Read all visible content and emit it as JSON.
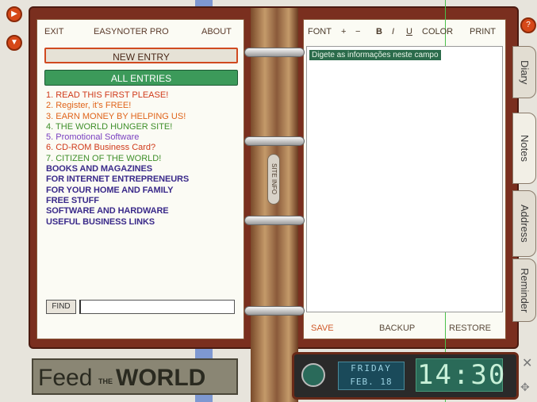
{
  "left_menu": {
    "exit": "EXIT",
    "title": "EASYNOTER PRO",
    "about": "ABOUT"
  },
  "buttons": {
    "new_entry": "NEW ENTRY",
    "all_entries": "ALL ENTRIES",
    "find": "FIND"
  },
  "entries": [
    {
      "text": "1. READ THIS FIRST PLEASE!",
      "color": "#d03a1a"
    },
    {
      "text": "2. Register, it's FREE!",
      "color": "#e0641a"
    },
    {
      "text": "3. EARN MONEY BY HELPING US!",
      "color": "#e0641a"
    },
    {
      "text": "4. THE WORLD HUNGER SITE!",
      "color": "#3f8f2a"
    },
    {
      "text": "5. Promotional Software",
      "color": "#7a40c0"
    },
    {
      "text": "6. CD-ROM Business Card?",
      "color": "#d03a1a"
    },
    {
      "text": "7. CITIZEN OF THE WORLD!",
      "color": "#3f8f2a"
    }
  ],
  "categories": [
    "BOOKS AND MAGAZINES",
    "FOR INTERNET ENTREPRENEURS",
    "FOR YOUR HOME AND FAMILY",
    "FREE STUFF",
    "SOFTWARE AND HARDWARE",
    "USEFUL BUSINESS LINKS"
  ],
  "toolbar": {
    "font": "FONT",
    "plus": "+",
    "minus": "−",
    "bold": "B",
    "italic": "I",
    "underline": "U",
    "color": "COLOR",
    "print": "PRINT"
  },
  "editor": {
    "text": "Digete as informações neste campo"
  },
  "bottom": {
    "save": "SAVE",
    "backup": "BACKUP",
    "restore": "RESTORE"
  },
  "tabs": [
    "Diary",
    "Notes",
    "Address",
    "Reminder"
  ],
  "spine_label": "SITE INFO",
  "branding": {
    "feed": "Feed",
    "the": "THE",
    "world": "WORLD"
  },
  "clock": {
    "day": "FRIDAY",
    "date": "FEB. 18",
    "time": "14:30"
  },
  "icons": {
    "close": "x-icon",
    "move": "move-icon",
    "help": "question-icon"
  },
  "colors": {
    "frame": "#7a2f1f",
    "accent_green": "#3c9a5a",
    "new_entry_border": "#d04a20"
  }
}
